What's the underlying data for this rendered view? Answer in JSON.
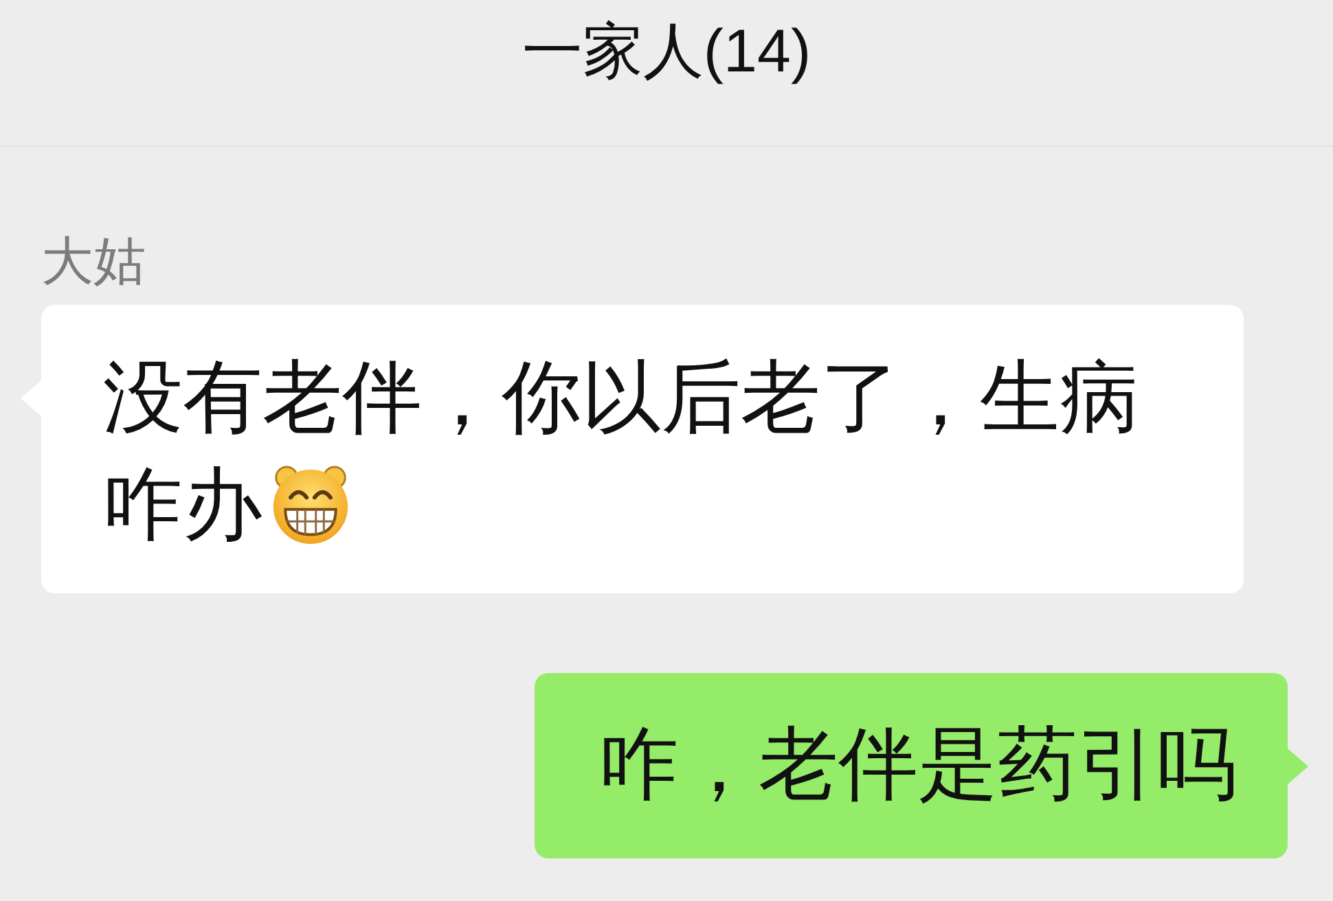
{
  "header": {
    "title": "一家人(14)"
  },
  "messages": [
    {
      "kind": "incoming",
      "sender": "大姑",
      "lines": [
        [
          {
            "kind": "text",
            "text": "没有老伴，你以后老了，生病"
          }
        ],
        [
          {
            "kind": "text",
            "text": "咋办"
          },
          {
            "kind": "emoji"
          }
        ]
      ]
    },
    {
      "kind": "outgoing",
      "lines": [
        [
          {
            "kind": "text",
            "text": "咋，老伴是药引吗"
          }
        ]
      ]
    }
  ]
}
